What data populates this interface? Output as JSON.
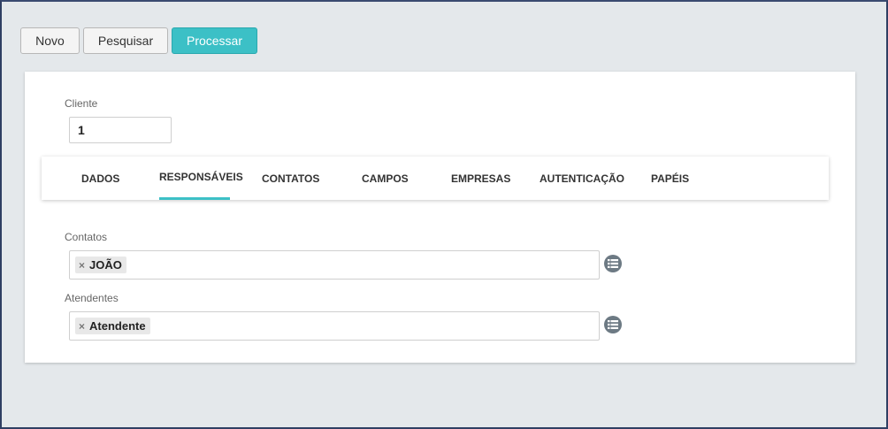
{
  "toolbar": {
    "novo_label": "Novo",
    "pesquisar_label": "Pesquisar",
    "processar_label": "Processar"
  },
  "form": {
    "cliente_label": "Cliente",
    "cliente_value": "1",
    "tabs": [
      {
        "label": "DADOS"
      },
      {
        "label": "RESPONSÁVEIS",
        "active": true
      },
      {
        "label": "CONTATOS"
      },
      {
        "label": "CAMPOS"
      },
      {
        "label": "EMPRESAS"
      },
      {
        "label": "AUTENTICAÇÃO"
      },
      {
        "label": "PAPÉIS"
      }
    ],
    "contatos_label": "Contatos",
    "contatos_tags": [
      "JOÃO"
    ],
    "atendentes_label": "Atendentes",
    "atendentes_tags": [
      "Atendente"
    ],
    "tag_remove_glyph": "×"
  },
  "icons": {
    "list_button": "list-icon",
    "tag_remove": "close-icon"
  },
  "colors": {
    "accent": "#3cc0c6",
    "background": "#e4e8eb",
    "icon_button": "#6d7a84"
  }
}
